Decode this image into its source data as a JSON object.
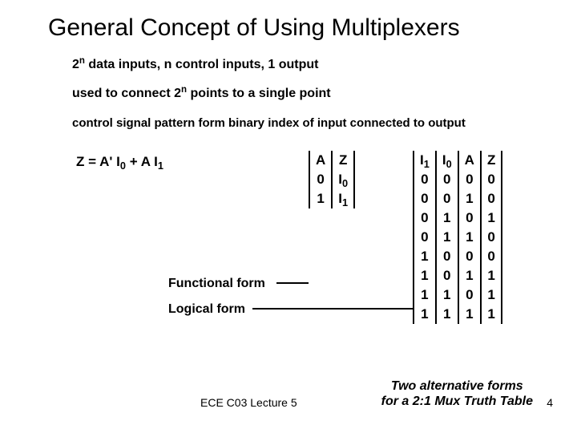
{
  "title": "General Concept of Using Multiplexers",
  "bullets": {
    "b1a": "2",
    "b1sup": "n",
    "b1b": " data inputs, n control inputs, 1 output",
    "b2a": "used to connect 2",
    "b2sup": "n",
    "b2b": " points to a single point",
    "b3": "control signal pattern form binary index of input connected to output"
  },
  "equation": {
    "pre": "Z = A' I",
    "s0": "0",
    "mid": " +   A I",
    "s1": "1"
  },
  "labels": {
    "functional": "Functional form",
    "logical": "Logical form"
  },
  "footer": {
    "left": "ECE C03 Lecture 5",
    "right1": "Two alternative forms",
    "right2": "for a 2:1 Mux Truth Table",
    "pagenum": "4"
  },
  "chart_data": [
    {
      "type": "table",
      "title": "2:1 Mux functional truth table",
      "columns": [
        "A",
        "Z"
      ],
      "rows": [
        [
          "0",
          "I0"
        ],
        [
          "1",
          "I1"
        ]
      ]
    },
    {
      "type": "table",
      "title": "2:1 Mux full truth table",
      "columns": [
        "I1",
        "I0",
        "A",
        "Z"
      ],
      "rows": [
        [
          "0",
          "0",
          "0",
          "0"
        ],
        [
          "0",
          "0",
          "1",
          "0"
        ],
        [
          "0",
          "1",
          "0",
          "1"
        ],
        [
          "0",
          "1",
          "1",
          "0"
        ],
        [
          "1",
          "0",
          "0",
          "0"
        ],
        [
          "1",
          "0",
          "1",
          "1"
        ],
        [
          "1",
          "1",
          "0",
          "1"
        ],
        [
          "1",
          "1",
          "1",
          "1"
        ]
      ]
    }
  ]
}
